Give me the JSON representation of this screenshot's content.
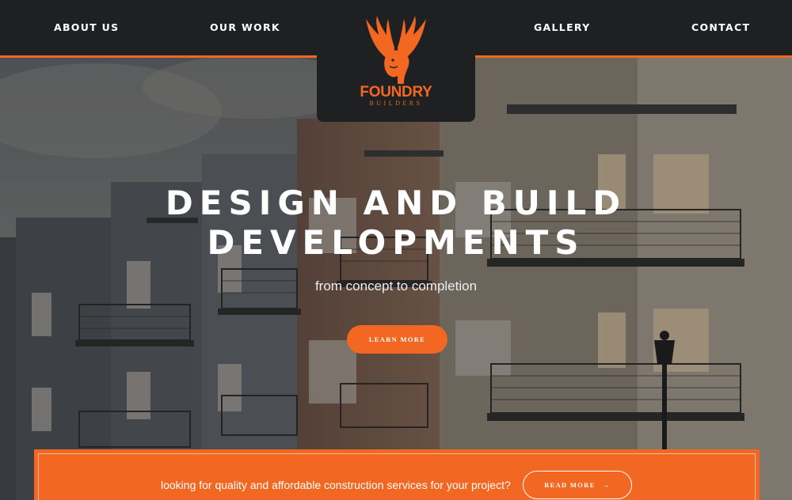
{
  "nav": {
    "about": "ABOUT US",
    "work": "OUR WORK",
    "gallery": "GALLERY",
    "contact": "CONTACT"
  },
  "logo": {
    "name": "FOUNDRY",
    "sub": "BUILDERS",
    "icon": "winged-horse-icon"
  },
  "hero": {
    "headline_line1": "DESIGN AND BUILD",
    "headline_line2": "DEVELOPMENTS",
    "tagline": "from concept to completion",
    "button": "LEARN MORE"
  },
  "cta": {
    "text": "looking for quality and affordable construction services for your project?",
    "button": "READ MORE",
    "button_icon": "arrow-right-icon"
  },
  "colors": {
    "accent": "#f26722",
    "header": "#1f2021"
  }
}
